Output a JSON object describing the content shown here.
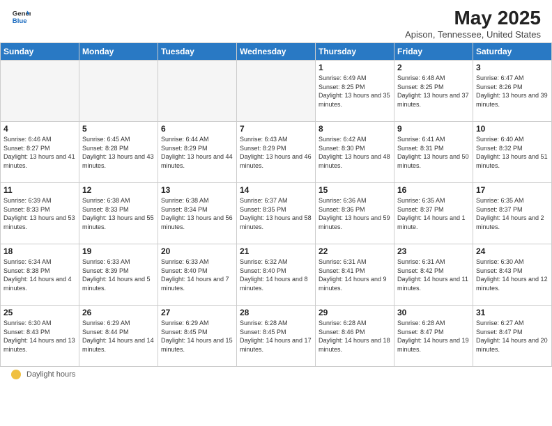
{
  "header": {
    "logo_general": "General",
    "logo_blue": "Blue",
    "month_title": "May 2025",
    "location": "Apison, Tennessee, United States"
  },
  "days_of_week": [
    "Sunday",
    "Monday",
    "Tuesday",
    "Wednesday",
    "Thursday",
    "Friday",
    "Saturday"
  ],
  "footer": {
    "label": "Daylight hours"
  },
  "weeks": [
    [
      {
        "day": "",
        "sunrise": "",
        "sunset": "",
        "daylight": ""
      },
      {
        "day": "",
        "sunrise": "",
        "sunset": "",
        "daylight": ""
      },
      {
        "day": "",
        "sunrise": "",
        "sunset": "",
        "daylight": ""
      },
      {
        "day": "",
        "sunrise": "",
        "sunset": "",
        "daylight": ""
      },
      {
        "day": "1",
        "sunrise": "Sunrise: 6:49 AM",
        "sunset": "Sunset: 8:25 PM",
        "daylight": "Daylight: 13 hours and 35 minutes."
      },
      {
        "day": "2",
        "sunrise": "Sunrise: 6:48 AM",
        "sunset": "Sunset: 8:25 PM",
        "daylight": "Daylight: 13 hours and 37 minutes."
      },
      {
        "day": "3",
        "sunrise": "Sunrise: 6:47 AM",
        "sunset": "Sunset: 8:26 PM",
        "daylight": "Daylight: 13 hours and 39 minutes."
      }
    ],
    [
      {
        "day": "4",
        "sunrise": "Sunrise: 6:46 AM",
        "sunset": "Sunset: 8:27 PM",
        "daylight": "Daylight: 13 hours and 41 minutes."
      },
      {
        "day": "5",
        "sunrise": "Sunrise: 6:45 AM",
        "sunset": "Sunset: 8:28 PM",
        "daylight": "Daylight: 13 hours and 43 minutes."
      },
      {
        "day": "6",
        "sunrise": "Sunrise: 6:44 AM",
        "sunset": "Sunset: 8:29 PM",
        "daylight": "Daylight: 13 hours and 44 minutes."
      },
      {
        "day": "7",
        "sunrise": "Sunrise: 6:43 AM",
        "sunset": "Sunset: 8:29 PM",
        "daylight": "Daylight: 13 hours and 46 minutes."
      },
      {
        "day": "8",
        "sunrise": "Sunrise: 6:42 AM",
        "sunset": "Sunset: 8:30 PM",
        "daylight": "Daylight: 13 hours and 48 minutes."
      },
      {
        "day": "9",
        "sunrise": "Sunrise: 6:41 AM",
        "sunset": "Sunset: 8:31 PM",
        "daylight": "Daylight: 13 hours and 50 minutes."
      },
      {
        "day": "10",
        "sunrise": "Sunrise: 6:40 AM",
        "sunset": "Sunset: 8:32 PM",
        "daylight": "Daylight: 13 hours and 51 minutes."
      }
    ],
    [
      {
        "day": "11",
        "sunrise": "Sunrise: 6:39 AM",
        "sunset": "Sunset: 8:33 PM",
        "daylight": "Daylight: 13 hours and 53 minutes."
      },
      {
        "day": "12",
        "sunrise": "Sunrise: 6:38 AM",
        "sunset": "Sunset: 8:33 PM",
        "daylight": "Daylight: 13 hours and 55 minutes."
      },
      {
        "day": "13",
        "sunrise": "Sunrise: 6:38 AM",
        "sunset": "Sunset: 8:34 PM",
        "daylight": "Daylight: 13 hours and 56 minutes."
      },
      {
        "day": "14",
        "sunrise": "Sunrise: 6:37 AM",
        "sunset": "Sunset: 8:35 PM",
        "daylight": "Daylight: 13 hours and 58 minutes."
      },
      {
        "day": "15",
        "sunrise": "Sunrise: 6:36 AM",
        "sunset": "Sunset: 8:36 PM",
        "daylight": "Daylight: 13 hours and 59 minutes."
      },
      {
        "day": "16",
        "sunrise": "Sunrise: 6:35 AM",
        "sunset": "Sunset: 8:37 PM",
        "daylight": "Daylight: 14 hours and 1 minute."
      },
      {
        "day": "17",
        "sunrise": "Sunrise: 6:35 AM",
        "sunset": "Sunset: 8:37 PM",
        "daylight": "Daylight: 14 hours and 2 minutes."
      }
    ],
    [
      {
        "day": "18",
        "sunrise": "Sunrise: 6:34 AM",
        "sunset": "Sunset: 8:38 PM",
        "daylight": "Daylight: 14 hours and 4 minutes."
      },
      {
        "day": "19",
        "sunrise": "Sunrise: 6:33 AM",
        "sunset": "Sunset: 8:39 PM",
        "daylight": "Daylight: 14 hours and 5 minutes."
      },
      {
        "day": "20",
        "sunrise": "Sunrise: 6:33 AM",
        "sunset": "Sunset: 8:40 PM",
        "daylight": "Daylight: 14 hours and 7 minutes."
      },
      {
        "day": "21",
        "sunrise": "Sunrise: 6:32 AM",
        "sunset": "Sunset: 8:40 PM",
        "daylight": "Daylight: 14 hours and 8 minutes."
      },
      {
        "day": "22",
        "sunrise": "Sunrise: 6:31 AM",
        "sunset": "Sunset: 8:41 PM",
        "daylight": "Daylight: 14 hours and 9 minutes."
      },
      {
        "day": "23",
        "sunrise": "Sunrise: 6:31 AM",
        "sunset": "Sunset: 8:42 PM",
        "daylight": "Daylight: 14 hours and 11 minutes."
      },
      {
        "day": "24",
        "sunrise": "Sunrise: 6:30 AM",
        "sunset": "Sunset: 8:43 PM",
        "daylight": "Daylight: 14 hours and 12 minutes."
      }
    ],
    [
      {
        "day": "25",
        "sunrise": "Sunrise: 6:30 AM",
        "sunset": "Sunset: 8:43 PM",
        "daylight": "Daylight: 14 hours and 13 minutes."
      },
      {
        "day": "26",
        "sunrise": "Sunrise: 6:29 AM",
        "sunset": "Sunset: 8:44 PM",
        "daylight": "Daylight: 14 hours and 14 minutes."
      },
      {
        "day": "27",
        "sunrise": "Sunrise: 6:29 AM",
        "sunset": "Sunset: 8:45 PM",
        "daylight": "Daylight: 14 hours and 15 minutes."
      },
      {
        "day": "28",
        "sunrise": "Sunrise: 6:28 AM",
        "sunset": "Sunset: 8:45 PM",
        "daylight": "Daylight: 14 hours and 17 minutes."
      },
      {
        "day": "29",
        "sunrise": "Sunrise: 6:28 AM",
        "sunset": "Sunset: 8:46 PM",
        "daylight": "Daylight: 14 hours and 18 minutes."
      },
      {
        "day": "30",
        "sunrise": "Sunrise: 6:28 AM",
        "sunset": "Sunset: 8:47 PM",
        "daylight": "Daylight: 14 hours and 19 minutes."
      },
      {
        "day": "31",
        "sunrise": "Sunrise: 6:27 AM",
        "sunset": "Sunset: 8:47 PM",
        "daylight": "Daylight: 14 hours and 20 minutes."
      }
    ]
  ]
}
